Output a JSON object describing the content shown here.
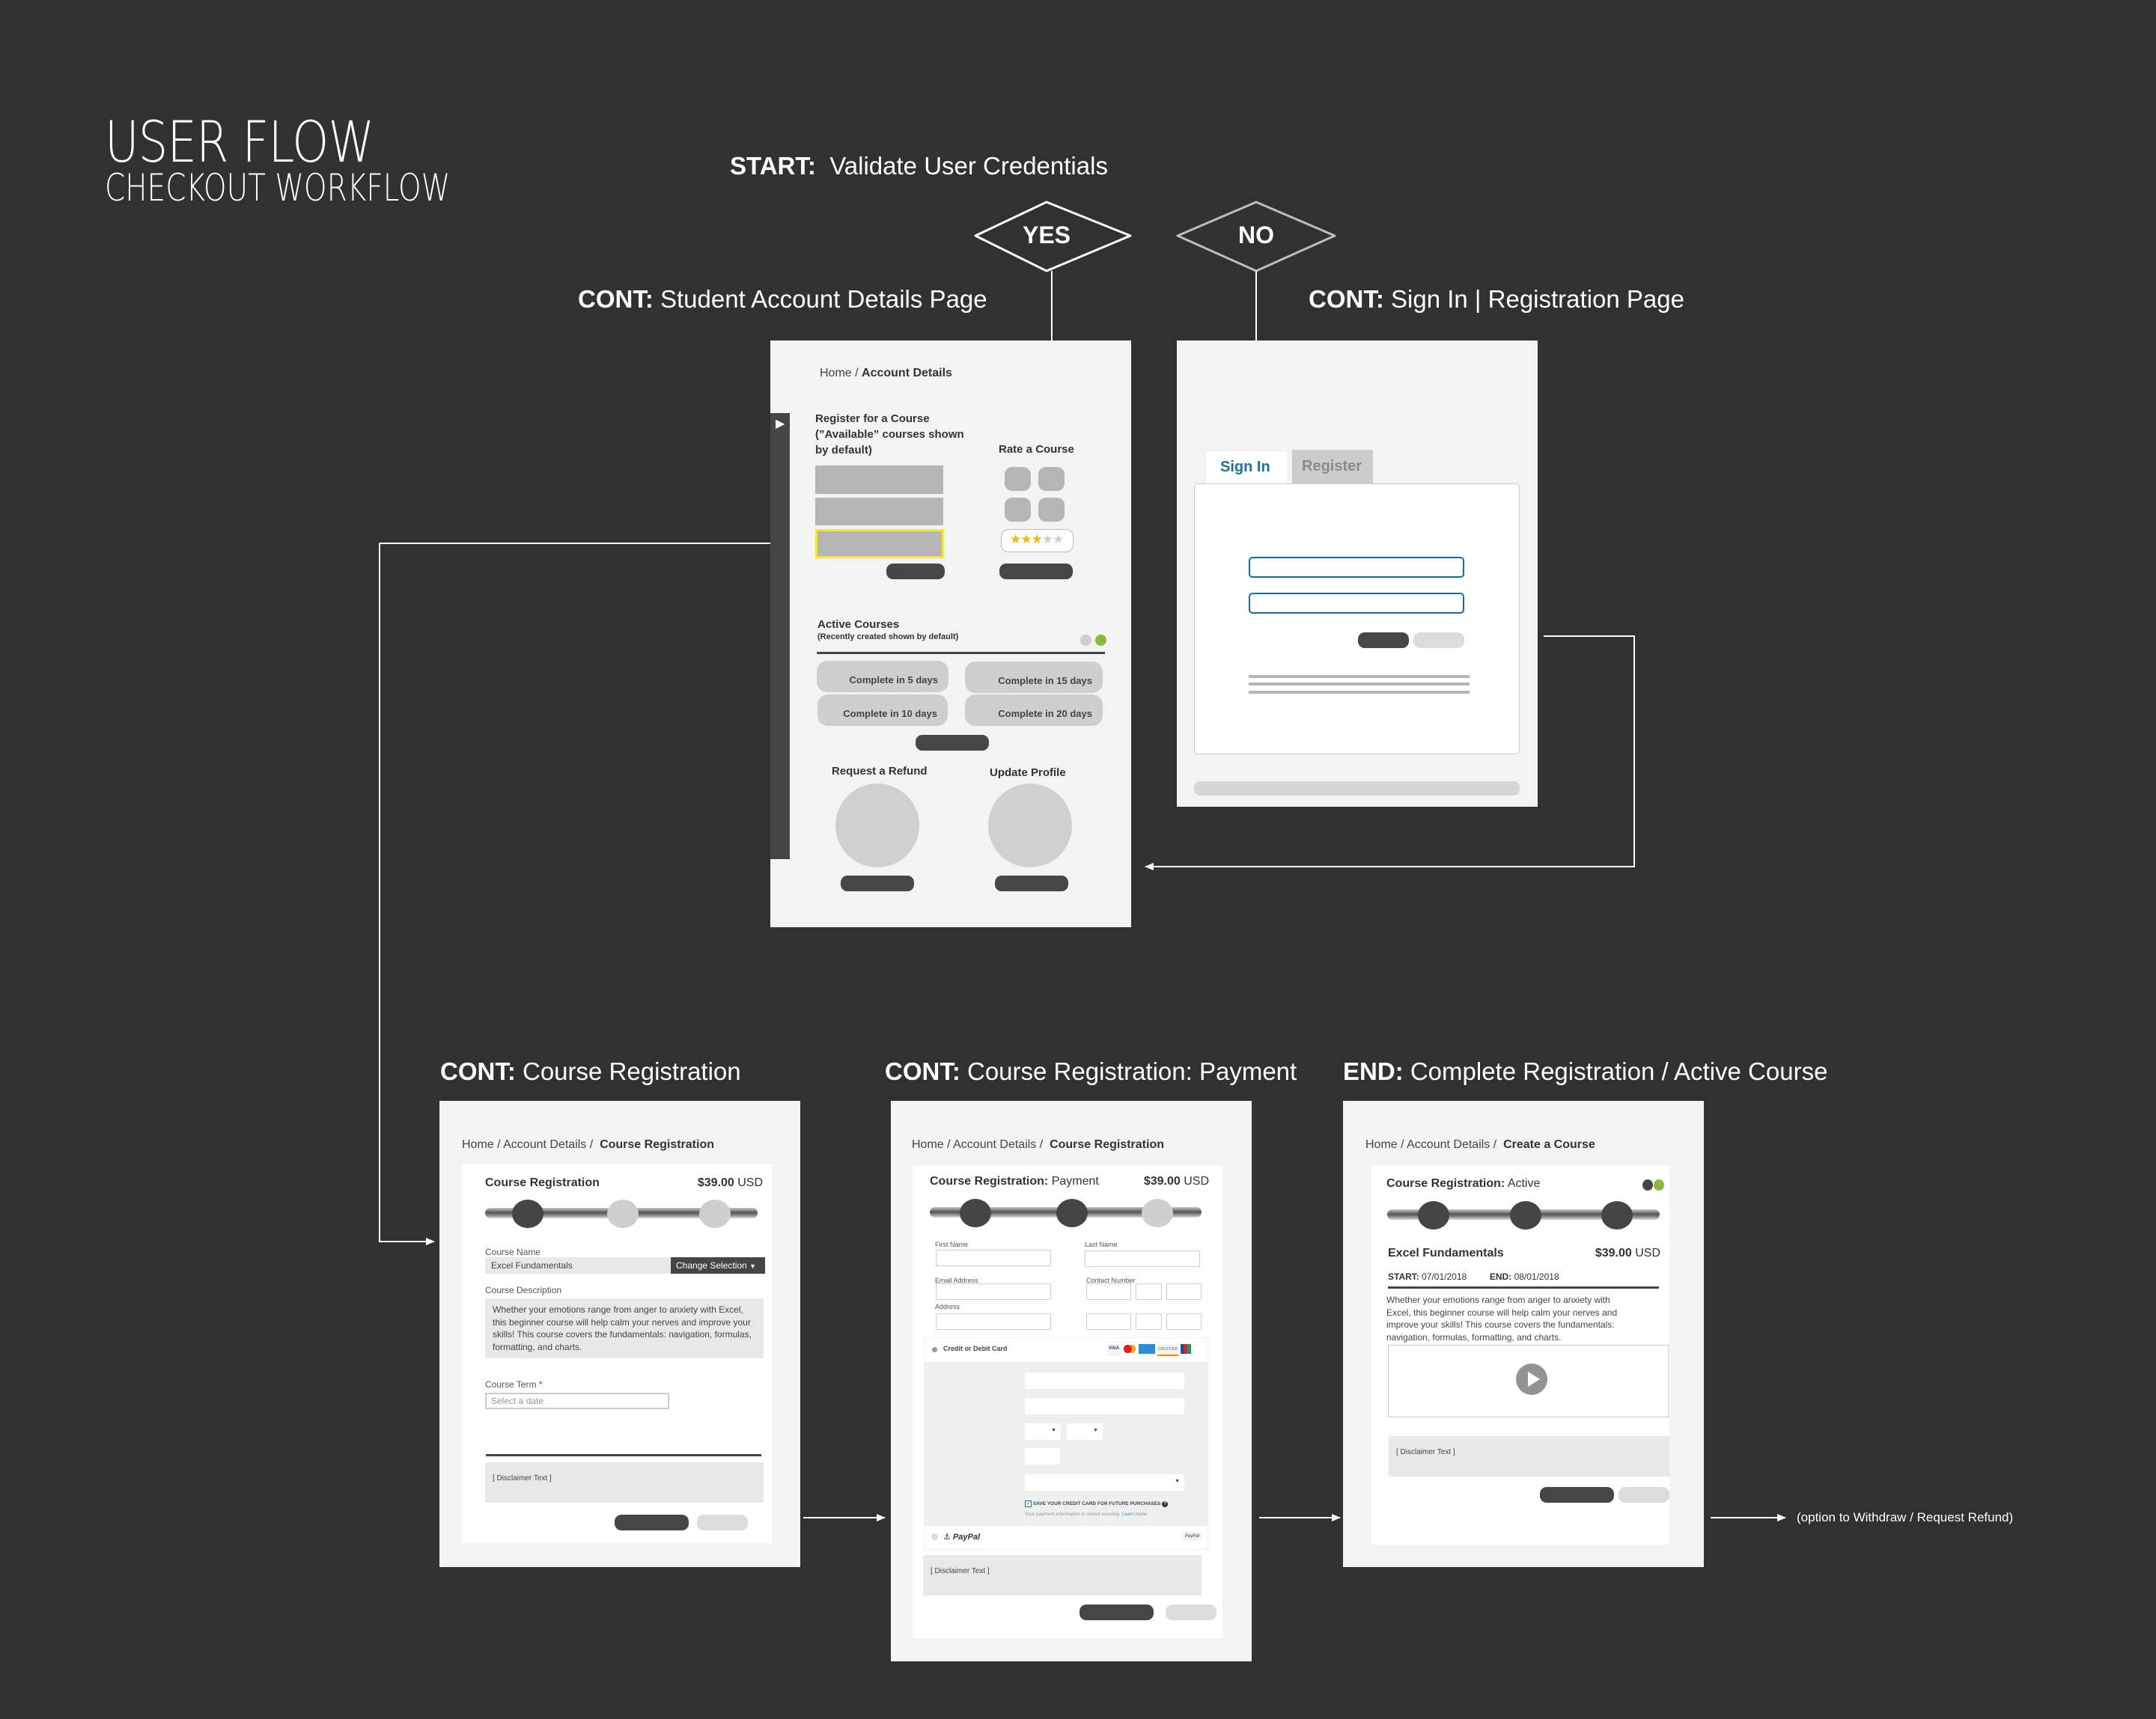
{
  "title": {
    "main": "USER FLOW",
    "sub": "CHECKOUT WORKFLOW"
  },
  "start": {
    "prefix": "START:",
    "text": "Validate User Credentials"
  },
  "decisions": {
    "yes": "YES",
    "no": "NO"
  },
  "steps": {
    "account": {
      "prefix": "CONT:",
      "text": "Student Account Details Page"
    },
    "signin": {
      "prefix": "CONT:",
      "text": "Sign In | Registration Page"
    },
    "course_reg": {
      "prefix": "CONT:",
      "text": "Course Registration"
    },
    "payment": {
      "prefix": "CONT:",
      "text": "Course Registration: Payment"
    },
    "end": {
      "prefix": "END:",
      "text": "Complete Registration / Active Course"
    }
  },
  "end_note": "(option to Withdraw / Request Refund)",
  "account_page": {
    "breadcrumb": {
      "home": "Home /",
      "current": "Account Details"
    },
    "register_heading": [
      "Register for a Course",
      "(”Available” courses shown",
      "by default)"
    ],
    "rate_heading": "Rate a Course",
    "rating": {
      "value": 3,
      "max": 5
    },
    "active_heading": "Active Courses",
    "active_sub": "(Recently created shown by default)",
    "active_tiles": [
      "Complete in 5 days",
      "Complete in 15 days",
      "Complete in 10 days",
      "Complete in 20 days"
    ],
    "refund_heading": "Request a Refund",
    "profile_heading": "Update Profile",
    "colors": {
      "highlight": "#ffec00",
      "toggle_on": "#8db73a",
      "star_on": "#f5b800"
    }
  },
  "signin_page": {
    "tab_signin": "Sign In",
    "tab_register": "Register",
    "colors": {
      "tab_active": "#1f6f9c",
      "input_border": "#1a6a9a"
    }
  },
  "course_reg_page": {
    "breadcrumb": {
      "path": "Home / Account Details /",
      "current": "Course Registration"
    },
    "heading": "Course Registration",
    "price": "$39.00",
    "currency": "USD",
    "progress_step": 1,
    "progress_total": 3,
    "course_name_label": "Course Name",
    "course_name_value": "Excel Fundamentals",
    "change_selection": "Change Selection",
    "desc_label": "Course Description",
    "description": "Whether your emotions range from anger to anxiety with Excel, this beginner course will help calm your nerves and improve your skills! This course covers the fundamentals: navigation, formulas, formatting, and charts.",
    "term_label": "Course Term",
    "term_required": "*",
    "term_placeholder": "Select a date",
    "disclaimer": "[ Disclaimer Text ]"
  },
  "payment_page": {
    "breadcrumb": {
      "path": "Home / Account Details /",
      "current": "Course Registration"
    },
    "heading_bold": "Course Registration:",
    "heading_rest": "Payment",
    "price": "$39.00",
    "currency": "USD",
    "progress_step": 2,
    "progress_total": 3,
    "first_name": "First Name",
    "last_name": "Last Name",
    "email": "Email Address",
    "contact": "Contact Number",
    "address": "Address",
    "card_option": "Credit or Debit Card",
    "card_brands": [
      "VISA",
      "MC",
      "AMEX",
      "DISCOVER",
      "JCB"
    ],
    "save_card": "SAVE YOUR CREDIT CARD FOR FUTURE PURCHASES",
    "secure_note": "Your payment information is stored securely.",
    "learn_more": "Learn more.",
    "paypal": "PayPal",
    "paypal_badge": "PayPal",
    "disclaimer": "[ Disclaimer Text ]"
  },
  "end_page": {
    "breadcrumb": {
      "path": "Home / Account Details /",
      "current": "Create a Course"
    },
    "heading_bold": "Course Registration:",
    "heading_rest": "Active",
    "progress_step": 3,
    "progress_total": 3,
    "course_name": "Excel Fundamentals",
    "price": "$39.00",
    "currency": "USD",
    "start_label": "START:",
    "start_date": "07/01/2018",
    "end_label": "END:",
    "end_date": "08/01/2018",
    "description": "Whether your emotions range from anger to anxiety with Excel, this beginner course will help calm your nerves and improve your skills! This course covers the fundamentals: navigation, formulas, formatting, and charts.",
    "disclaimer": "[ Disclaimer Text ]"
  }
}
